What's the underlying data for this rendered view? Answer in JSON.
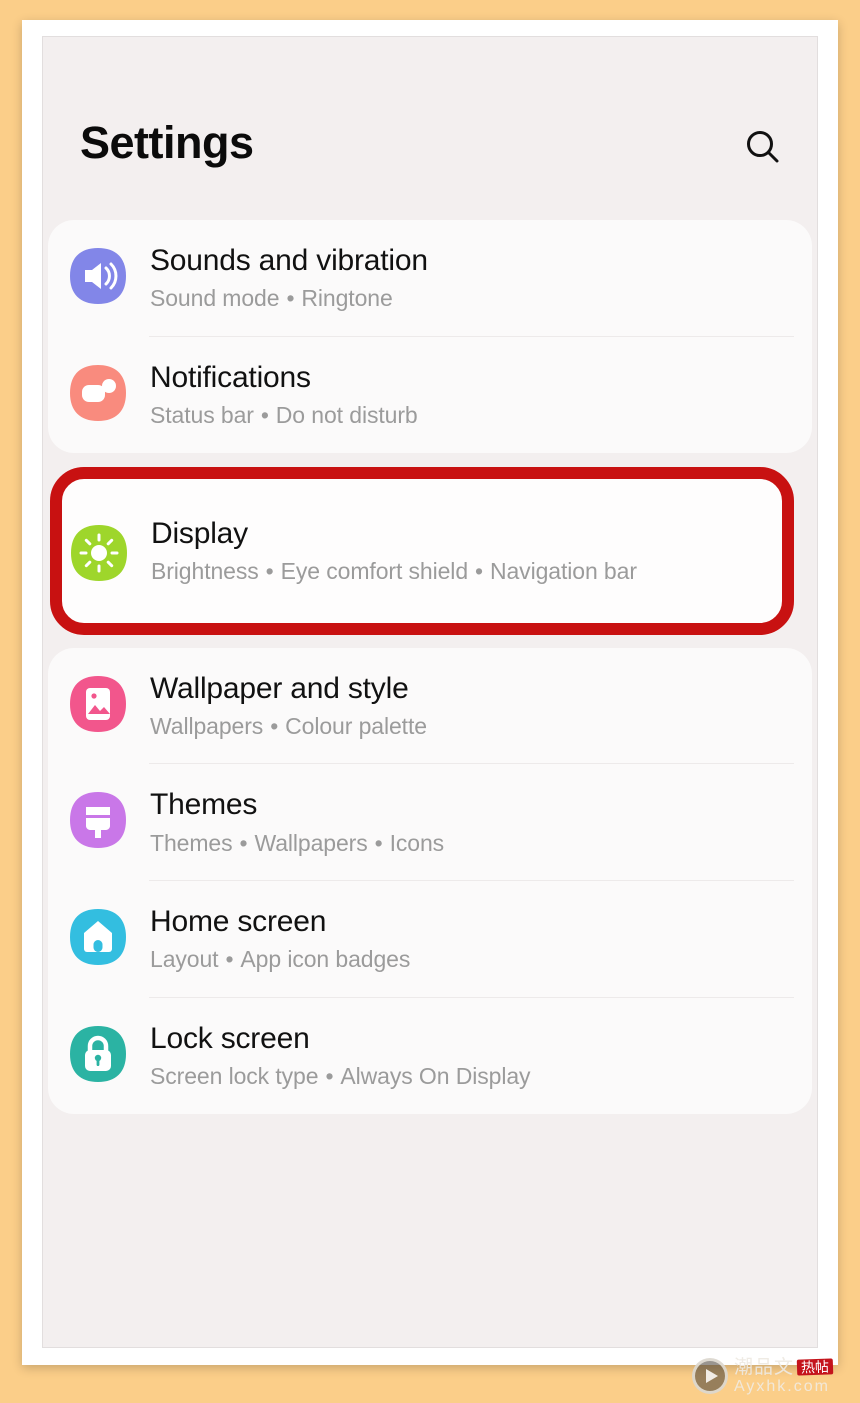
{
  "theme": {
    "page_background": "#FBCE89",
    "paper": "#FFFFFF",
    "screen_background": "#F3EFEF",
    "card_background": "#FBFAFA",
    "title_color": "#111111",
    "subtitle_color": "#9B9B9B",
    "highlight_color": "#C81111",
    "divider_color": "#EDEAEA"
  },
  "header": {
    "title": "Settings",
    "search_icon": "search-icon"
  },
  "groups": [
    {
      "id": "group-1",
      "highlighted": false,
      "items": [
        {
          "id": "sounds-and-vibration",
          "title": "Sounds and vibration",
          "subtitle_parts": [
            "Sound mode",
            "Ringtone"
          ],
          "icon": "speaker-icon",
          "icon_color": "#8286E8"
        },
        {
          "id": "notifications",
          "title": "Notifications",
          "subtitle_parts": [
            "Status bar",
            "Do not disturb"
          ],
          "icon": "notification-bubble-icon",
          "icon_color": "#F98B7E"
        }
      ]
    },
    {
      "id": "group-2-display",
      "highlighted": true,
      "items": [
        {
          "id": "display",
          "title": "Display",
          "subtitle_parts": [
            "Brightness",
            "Eye comfort shield",
            "Navigation bar"
          ],
          "icon": "brightness-sun-icon",
          "icon_color": "#9ED62B"
        }
      ]
    },
    {
      "id": "group-3",
      "highlighted": false,
      "items": [
        {
          "id": "wallpaper-and-style",
          "title": "Wallpaper and style",
          "subtitle_parts": [
            "Wallpapers",
            "Colour palette"
          ],
          "icon": "image-picture-icon",
          "icon_color": "#F2568C"
        },
        {
          "id": "themes",
          "title": "Themes",
          "subtitle_parts": [
            "Themes",
            "Wallpapers",
            "Icons"
          ],
          "icon": "paintbrush-icon",
          "icon_color": "#C977E8"
        },
        {
          "id": "home-screen",
          "title": "Home screen",
          "subtitle_parts": [
            "Layout",
            "App icon badges"
          ],
          "icon": "home-house-icon",
          "icon_color": "#33BEE0"
        },
        {
          "id": "lock-screen",
          "title": "Lock screen",
          "subtitle_parts": [
            "Screen lock type",
            "Always On Display"
          ],
          "icon": "padlock-icon",
          "icon_color": "#2BB3A3"
        }
      ]
    }
  ],
  "separator": "•",
  "watermark": {
    "play_icon": "play-button-icon",
    "brand_cn": "潮品文",
    "seal_cn": "热帖",
    "url": "Ayxhk.com"
  }
}
